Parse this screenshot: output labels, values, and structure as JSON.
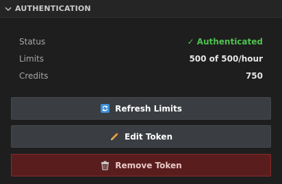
{
  "section": {
    "title": "AUTHENTICATION",
    "chevron_icon": "chevron-down-icon"
  },
  "info": {
    "status_label": "Status",
    "status_value": "✓ Authenticated",
    "limits_label": "Limits",
    "limits_value": "500 of 500/hour",
    "credits_label": "Credits",
    "credits_value": "750"
  },
  "buttons": {
    "refresh_label": "Refresh Limits",
    "refresh_icon": "refresh-icon",
    "edit_label": "Edit Token",
    "edit_icon": "pencil-icon",
    "remove_label": "Remove Token",
    "remove_icon": "trash-icon"
  },
  "colors": {
    "success": "#4ec24e",
    "danger_bg": "#5a1d1d",
    "danger_border": "#8b2b2b"
  }
}
